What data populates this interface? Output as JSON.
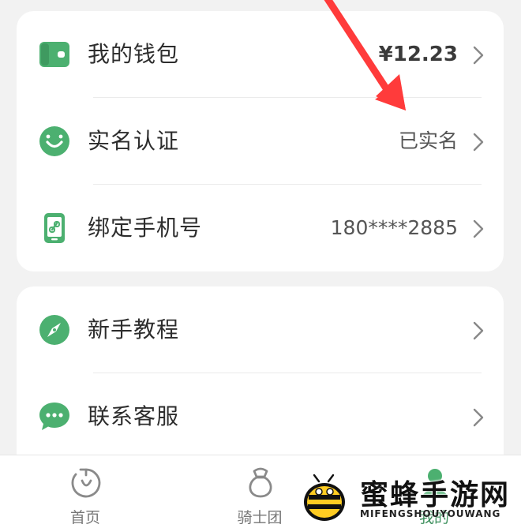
{
  "card1": {
    "rows": [
      {
        "icon": "wallet-icon",
        "label": "我的钱包",
        "value": "¥12.23"
      },
      {
        "icon": "smile-verify-icon",
        "label": "实名认证",
        "value": "已实名"
      },
      {
        "icon": "phone-link-icon",
        "label": "绑定手机号",
        "value": "180****2885"
      }
    ]
  },
  "card2": {
    "rows": [
      {
        "icon": "compass-icon",
        "label": "新手教程"
      },
      {
        "icon": "chat-bubble-icon",
        "label": "联系客服"
      }
    ]
  },
  "tabbar": {
    "tabs": [
      {
        "icon": "home-refresh-icon",
        "label": "首页"
      },
      {
        "icon": "knight-bag-icon",
        "label": "骑士团"
      },
      {
        "icon": "profile-icon",
        "label": "我的",
        "active": true
      }
    ]
  },
  "watermark": {
    "title": "蜜蜂手游网",
    "subtitle": "MIFENGSHOUYOUWANG"
  },
  "colors": {
    "accent_green": "#4cb070",
    "arrow_red": "#ff3b3b",
    "background": "#f2f2f2"
  }
}
